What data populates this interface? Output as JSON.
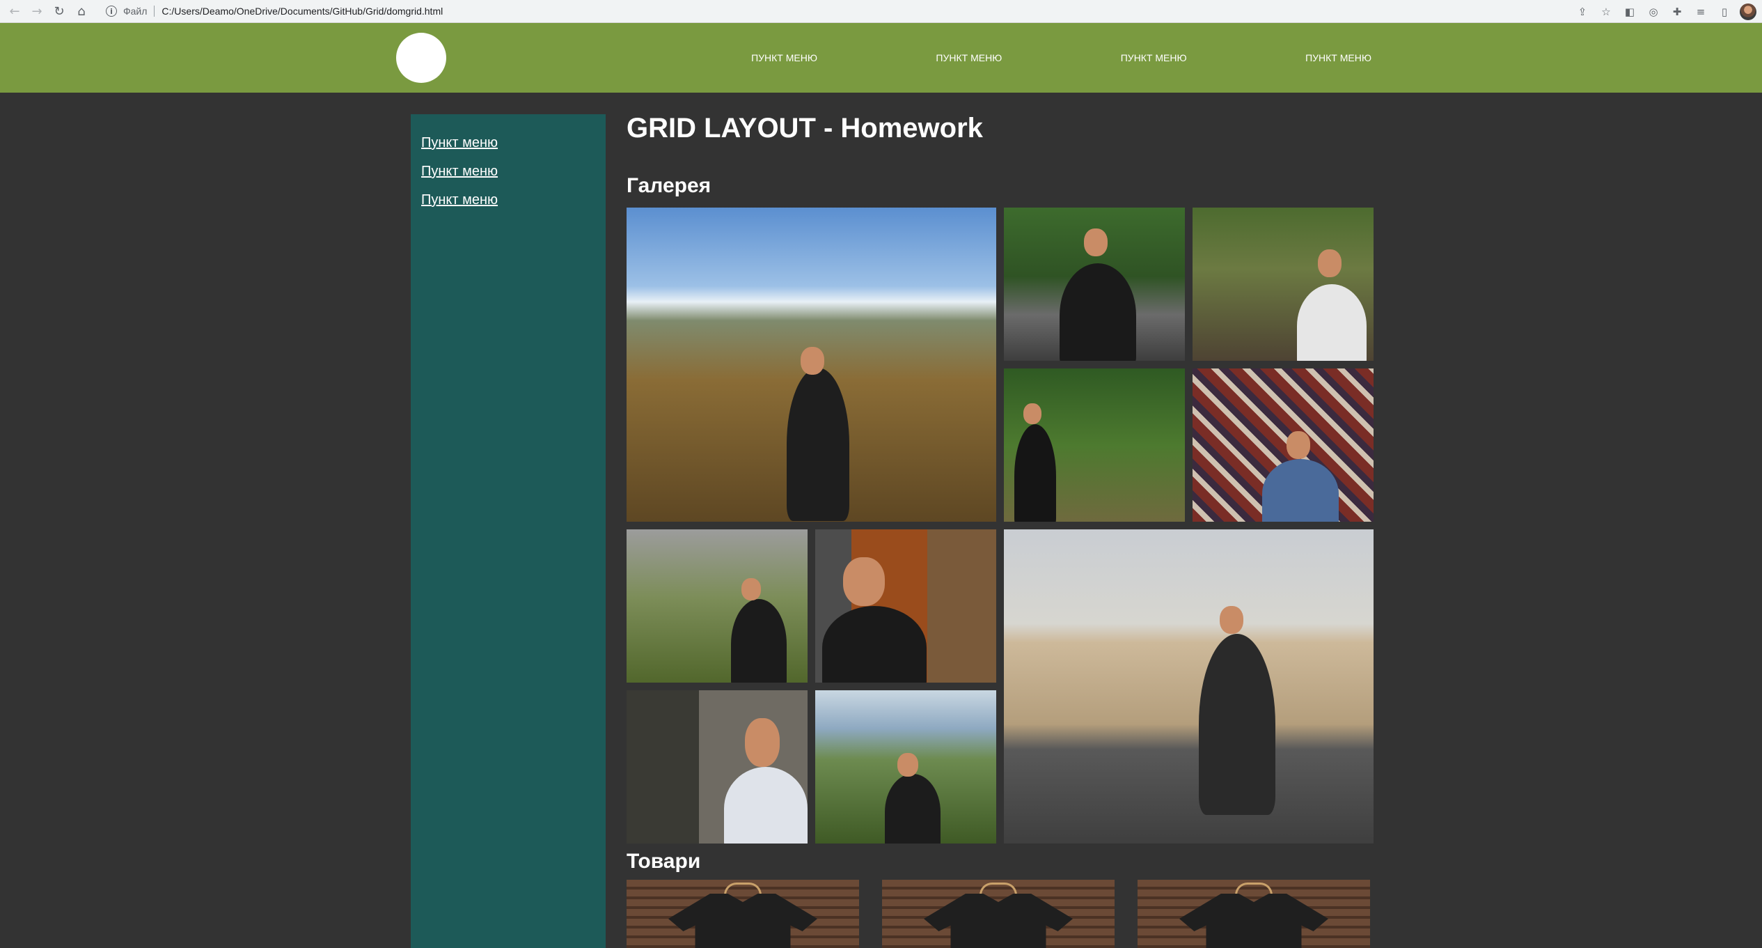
{
  "browser": {
    "file_label": "Файл",
    "url": "C:/Users/Deamo/OneDrive/Documents/GitHub/Grid/domgrid.html"
  },
  "header": {
    "nav": [
      {
        "label": "ПУНКТ МЕНЮ"
      },
      {
        "label": "ПУНКТ МЕНЮ"
      },
      {
        "label": "ПУНКТ МЕНЮ"
      },
      {
        "label": "ПУНКТ МЕНЮ"
      }
    ]
  },
  "sidebar": {
    "items": [
      {
        "label": "Пункт меню"
      },
      {
        "label": "Пункт меню"
      },
      {
        "label": "Пункт меню"
      }
    ]
  },
  "main": {
    "title": "GRID LAYOUT - Homework",
    "gallery_title": "Галерея",
    "shop_title": "Товари"
  },
  "colors": {
    "header_bg": "#7a9a40",
    "page_bg": "#333333",
    "sidebar_bg": "#1d5a58"
  }
}
